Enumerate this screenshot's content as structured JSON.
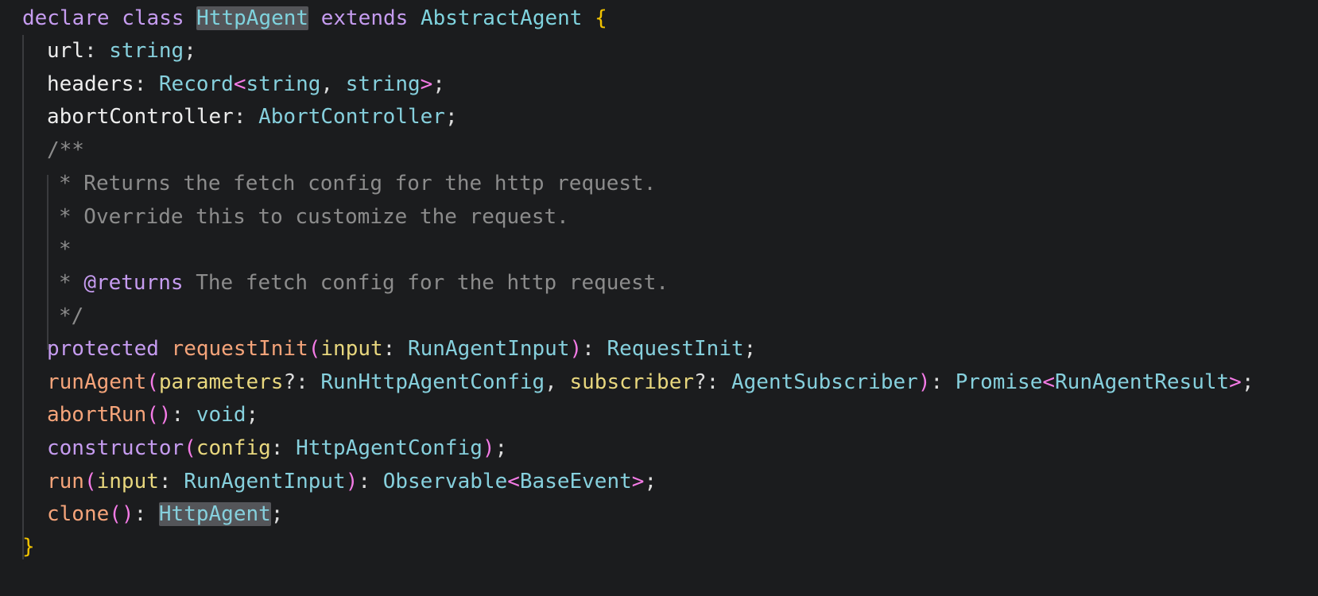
{
  "code": {
    "l1": {
      "declare": "declare",
      "class": "class",
      "name": "HttpAgent",
      "extends": "extends",
      "base": "AbstractAgent",
      "open": "{"
    },
    "l2": {
      "prop": "url",
      "colon": ": ",
      "type": "string",
      "semi": ";"
    },
    "l3": {
      "prop": "headers",
      "colon": ": ",
      "type": "Record",
      "lt": "<",
      "t1": "string",
      "comma": ", ",
      "t2": "string",
      "gt": ">",
      "semi": ";"
    },
    "l4": {
      "prop": "abortController",
      "colon": ": ",
      "type": "AbortController",
      "semi": ";"
    },
    "l5": {
      "text": "/**"
    },
    "l6": {
      "text": "* Returns the fetch config for the http request."
    },
    "l7": {
      "text": "* Override this to customize the request."
    },
    "l8": {
      "text": "*"
    },
    "l9": {
      "star": "* ",
      "tag": "@returns",
      "text": " The fetch config for the http request."
    },
    "l10": {
      "text": "*/"
    },
    "l11": {
      "mod": "protected",
      "sp": " ",
      "method": "requestInit",
      "po": "(",
      "param": "input",
      "colon": ": ",
      "ptype": "RunAgentInput",
      "pc": ")",
      "colon2": ": ",
      "rtype": "RequestInit",
      "semi": ";"
    },
    "l12": {
      "method": "runAgent",
      "po": "(",
      "p1": "parameters",
      "q1": "?: ",
      "t1": "RunHttpAgentConfig",
      "comma": ", ",
      "p2": "subscriber",
      "q2": "?: ",
      "t2": "AgentSubscriber",
      "pc": ")",
      "colon": ": ",
      "rtype": "Promise",
      "lt": "<",
      "inner": "RunAgentResult",
      "gt": ">",
      "semi": ";"
    },
    "l13": {
      "method": "abortRun",
      "parens": "()",
      "colon": ": ",
      "rtype": "void",
      "semi": ";"
    },
    "l14": {
      "ctor": "constructor",
      "po": "(",
      "param": "config",
      "colon": ": ",
      "ptype": "HttpAgentConfig",
      "pc": ")",
      "semi": ";"
    },
    "l15": {
      "method": "run",
      "po": "(",
      "param": "input",
      "colon": ": ",
      "ptype": "RunAgentInput",
      "pc": ")",
      "colon2": ": ",
      "rtype": "Observable",
      "lt": "<",
      "inner": "BaseEvent",
      "gt": ">",
      "semi": ";"
    },
    "l16": {
      "method": "clone",
      "parens": "()",
      "colon": ": ",
      "rtype": "HttpAgent",
      "semi": ";"
    },
    "l17": {
      "close": "}"
    }
  },
  "colors": {
    "background": "#1b1c1e",
    "keyword": "#c69cf0",
    "type": "#86d0dd",
    "method": "#f5a47a",
    "param": "#e8d77e",
    "comment": "#8c8c8c",
    "brace": "#f2c300",
    "paren": "#f47be6",
    "highlight": "#545559"
  }
}
